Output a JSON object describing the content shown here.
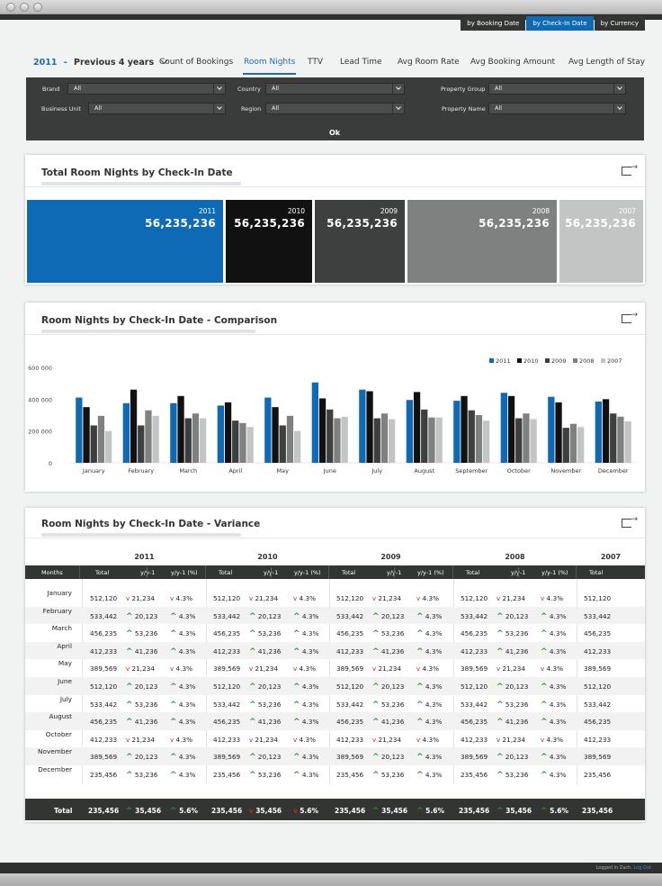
{
  "view_tabs": [
    {
      "label": "by Booking Date",
      "active": false
    },
    {
      "label": "by Check-In Date",
      "active": true
    },
    {
      "label": "by Currency",
      "active": false
    }
  ],
  "period": {
    "year": "2011",
    "separator": "-",
    "label": "Previous 4 years"
  },
  "metric_tabs": [
    {
      "label": "Count of Bookings",
      "active": false
    },
    {
      "label": "Room Nights",
      "active": true
    },
    {
      "label": "TTV",
      "active": false
    },
    {
      "label": "Lead Time",
      "active": false
    },
    {
      "label": "Avg Room Rate",
      "active": false
    },
    {
      "label": "Avg Booking Amount",
      "active": false
    },
    {
      "label": "Avg Length of Stay",
      "active": false
    }
  ],
  "filters": [
    {
      "label": "Brand",
      "value": "All"
    },
    {
      "label": "Country",
      "value": "All"
    },
    {
      "label": "Property Group",
      "value": "All"
    },
    {
      "label": "Business Unit",
      "value": "All"
    },
    {
      "label": "Region",
      "value": "All"
    },
    {
      "label": "Property Name",
      "value": "All"
    }
  ],
  "ok_label": "Ok",
  "totals_panel": {
    "title": "Total Room Nights by Check-In Date",
    "tiles": [
      {
        "year": "2011",
        "value": "56,235,236",
        "color": "#0f6ab5"
      },
      {
        "year": "2010",
        "value": "56,235,236",
        "color": "#111111"
      },
      {
        "year": "2009",
        "value": "56,235,236",
        "color": "#3e403f"
      },
      {
        "year": "2008",
        "value": "56,235,236",
        "color": "#7e817f"
      },
      {
        "year": "2007",
        "value": "56,235,236",
        "color": "#c3c5c4"
      }
    ]
  },
  "comparison_panel": {
    "title": "Room Nights by Check-In Date - Comparison"
  },
  "chart_data": {
    "type": "bar",
    "categories": [
      "January",
      "February",
      "March",
      "April",
      "May",
      "June",
      "July",
      "August",
      "September",
      "October",
      "November",
      "December"
    ],
    "series": [
      {
        "name": "2011",
        "color": "#0f6ab5",
        "values": [
          410000,
          375000,
          375000,
          360000,
          410000,
          505000,
          460000,
          395000,
          390000,
          440000,
          415000,
          385000
        ]
      },
      {
        "name": "2010",
        "color": "#111111",
        "values": [
          350000,
          460000,
          420000,
          380000,
          350000,
          405000,
          450000,
          445000,
          420000,
          420000,
          380000,
          400000
        ]
      },
      {
        "name": "2009",
        "color": "#3e403f",
        "values": [
          235000,
          235000,
          280000,
          265000,
          235000,
          335000,
          280000,
          335000,
          330000,
          280000,
          220000,
          310000
        ]
      },
      {
        "name": "2008",
        "color": "#7e817f",
        "values": [
          295000,
          330000,
          310000,
          250000,
          295000,
          280000,
          310000,
          285000,
          300000,
          310000,
          245000,
          290000
        ]
      },
      {
        "name": "2007",
        "color": "#c3c5c4",
        "values": [
          200000,
          295000,
          280000,
          225000,
          200000,
          290000,
          275000,
          285000,
          265000,
          275000,
          225000,
          260000
        ]
      }
    ],
    "yticks": [
      "0",
      "200 000",
      "400 000",
      "600 000"
    ],
    "ylim": [
      0,
      600000
    ],
    "legend_position": "top-right",
    "grid": false
  },
  "variance_panel": {
    "title": "Room Nights by Check-In Date - Variance",
    "years": [
      "2011",
      "2010",
      "2009",
      "2008",
      "2007"
    ],
    "headers": {
      "months": "Months",
      "total": "Total",
      "yy": "y/y-1",
      "yypct": "y/y-1 (%)"
    },
    "rows": [
      {
        "month": "January",
        "total": "512,120",
        "yy": "21,234",
        "dir": "down",
        "pct": "4.3%"
      },
      {
        "month": "February",
        "total": "533,442",
        "yy": "20,123",
        "dir": "up",
        "pct": "4.3%"
      },
      {
        "month": "March",
        "total": "456,235",
        "yy": "53,236",
        "dir": "up",
        "pct": "4.3%"
      },
      {
        "month": "April",
        "total": "412,233",
        "yy": "41,236",
        "dir": "up",
        "pct": "4.3%"
      },
      {
        "month": "May",
        "total": "389,569",
        "yy": "21,234",
        "dir": "down",
        "pct": "4.3%"
      },
      {
        "month": "June",
        "total": "512,120",
        "yy": "20,123",
        "dir": "up",
        "pct": "4.3%"
      },
      {
        "month": "July",
        "total": "533,442",
        "yy": "53,236",
        "dir": "up",
        "pct": "4.3%"
      },
      {
        "month": "August",
        "total": "456,235",
        "yy": "41,236",
        "dir": "up",
        "pct": "4.3%"
      },
      {
        "month": "October",
        "total": "412,233",
        "yy": "21,234",
        "dir": "down",
        "pct": "4.3%"
      },
      {
        "month": "November",
        "total": "389,569",
        "yy": "20,123",
        "dir": "up",
        "pct": "4.3%"
      },
      {
        "month": "December",
        "total": "235,456",
        "yy": "53,236",
        "dir": "up",
        "pct": "4.3%"
      }
    ],
    "total_row": {
      "label": "Total",
      "cells": [
        {
          "total": "235,456",
          "yy": "35,456",
          "dir": "up",
          "pct": "5.6%",
          "pct_dir": "up"
        },
        {
          "total": "235,456",
          "yy": "35,456",
          "dir": "down",
          "pct": "5.6%",
          "pct_dir": "down"
        },
        {
          "total": "235,456",
          "yy": "35,456",
          "dir": "up",
          "pct": "5.6%",
          "pct_dir": "up"
        },
        {
          "total": "235,456",
          "yy": "35,456",
          "dir": "up",
          "pct": "5.6%",
          "pct_dir": "up"
        },
        {
          "total": "235,456"
        }
      ]
    }
  },
  "footer": {
    "logged_in": "Logged in Zach.",
    "logout": "Log Out"
  },
  "icons": {
    "export": "export-icon",
    "dropdown": "chevron-down-icon",
    "up": "arrow-up-icon",
    "down": "arrow-down-icon"
  }
}
